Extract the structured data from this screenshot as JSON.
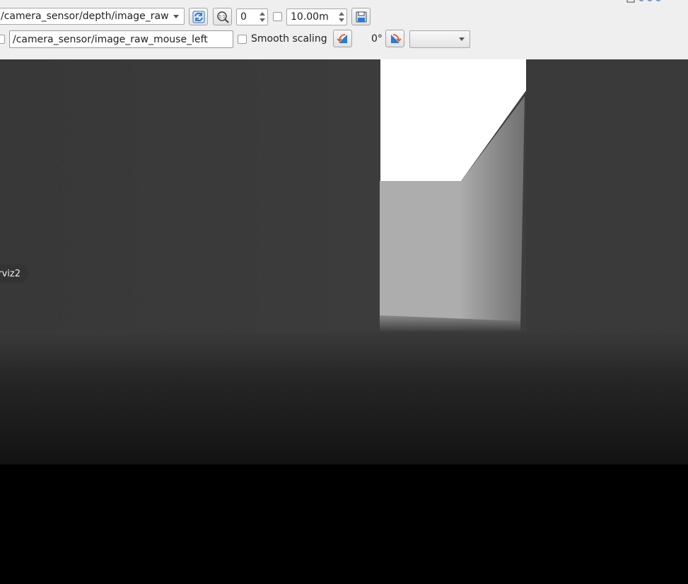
{
  "toolbar": {
    "topic_selected": "/camera_sensor/depth/image_raw",
    "zoom_value": "0",
    "max_range_value": "10.00m",
    "mouse_topic": "/camera_sensor/image_raw_mouse_left",
    "smooth_scaling_label": "Smooth scaling",
    "rotation_label": "0°",
    "extra_select_value": ""
  },
  "view": {
    "tooltip": "rviz2"
  },
  "colors": {
    "toolbar_bg": "#efefef",
    "accent_icon": "#2a7ad6",
    "rotate_icon_accent": "#e0592a"
  }
}
